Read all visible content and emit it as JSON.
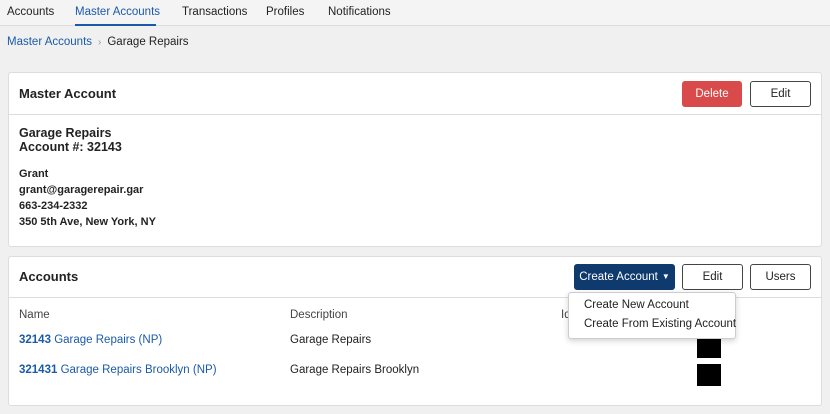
{
  "nav": {
    "tabs": [
      {
        "label": "Accounts",
        "active": false
      },
      {
        "label": "Master Accounts",
        "active": true
      },
      {
        "label": "Transactions",
        "active": false
      },
      {
        "label": "Profiles",
        "active": false
      },
      {
        "label": "Notifications",
        "active": false
      }
    ]
  },
  "breadcrumb": {
    "parent": "Master Accounts",
    "separator": "›",
    "current": "Garage Repairs"
  },
  "master_account": {
    "title": "Master Account",
    "delete_label": "Delete",
    "edit_label": "Edit",
    "name": "Garage Repairs",
    "account_number": "Account #: 32143",
    "contact_name": "Grant",
    "email": "grant@garagerepair.gar",
    "phone": "663-234-2332",
    "address": "350 5th Ave, New York, NY"
  },
  "accounts": {
    "title": "Accounts",
    "create_label": "Create Account",
    "edit_label": "Edit",
    "users_label": "Users",
    "columns": {
      "name": "Name",
      "description": "Description",
      "id": "Id"
    },
    "rows": [
      {
        "number": "32143",
        "name": "Garage Repairs (NP)",
        "description": "Garage Repairs"
      },
      {
        "number": "321431",
        "name": "Garage Repairs Brooklyn (NP)",
        "description": "Garage Repairs Brooklyn"
      }
    ],
    "dropdown": {
      "items": [
        "Create New Account",
        "Create From Existing Account"
      ]
    }
  },
  "colors": {
    "link": "#1a5aa8",
    "danger": "#d94a4a",
    "primary": "#0f3a6e",
    "background": "#f0f0f0"
  }
}
